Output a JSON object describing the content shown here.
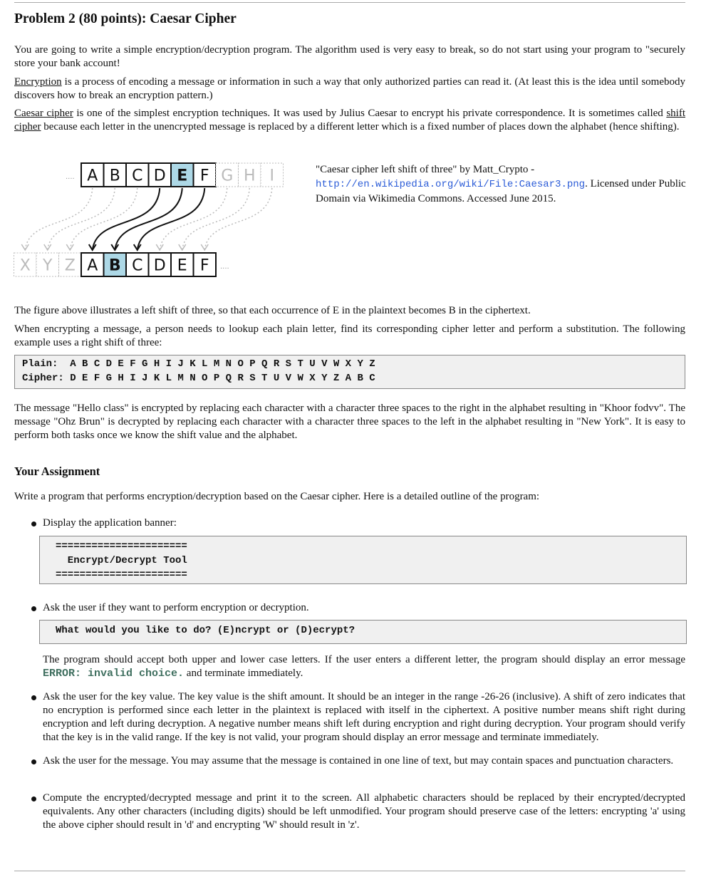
{
  "title": "Problem 2 (80 points): Caesar Cipher",
  "intro": {
    "p1": "You are going to write a simple encryption/decryption program. The algorithm used is very easy to break, so do not start using your program to \"securely store your bank account!",
    "p2_link": "Encryption",
    "p2": " is a process of encoding a message or information in such a way that only authorized parties can read it. (At least this is the idea until somebody discovers how to break an encryption pattern.)",
    "p3_link1": "Caesar cipher",
    "p3_a": " is one of the simplest encryption techniques. It was used by Julius Caesar to encrypt his private correspondence. It is sometimes called ",
    "p3_link2": "shift cipher",
    "p3_b": " because each letter in the unencrypted message is replaced by a different letter which is a fixed number of places down the alphabet (hence shifting)."
  },
  "figure": {
    "top_letters": [
      "A",
      "B",
      "C",
      "D",
      "E",
      "F"
    ],
    "top_gray": [
      "G",
      "H",
      "I"
    ],
    "bottom_gray": [
      "X",
      "Y",
      "Z"
    ],
    "bottom_letters": [
      "A",
      "B",
      "C",
      "D",
      "E",
      "F"
    ],
    "ellipsis": "....",
    "highlight_color": "#add8e6",
    "caption_a": "\"Caesar cipher left shift of three\" by Matt_Crypto - ",
    "caption_url": "http://en.wikipedia.org/wiki/File:Caesar3.png",
    "caption_b": ". Licensed under Public Domain via Wikimedia Commons. Accessed June 2015."
  },
  "p4": "The figure above illustrates a left shift of three, so that each occurrence of E in the plaintext becomes B in the ciphertext.",
  "p5": "When encrypting a message, a person needs to lookup each plain letter, find its corresponding cipher letter and perform a substitution. The following example uses a right shift of three:",
  "table": {
    "plain": "Plain:  A B C D E F G H I J K L M N O P Q R S T U V W X Y Z",
    "cipher": "Cipher: D E F G H I J K L M N O P Q R S T U V W X Y Z A B C"
  },
  "p6": "The message \"Hello class\" is encrypted by replacing each character with a character three spaces to the right in the alphabet resulting in \"Khoor fodvv\". The message \"Ohz Brun\" is decrypted by replacing each character with a character three spaces to the left in the alphabet resulting in \"New York\". It is easy to perform both tasks once we know the shift value and the alphabet.",
  "assignment": {
    "heading": "Your Assignment",
    "intro": "Write a program that performs encryption/decryption based on the Caesar cipher. Here is a detailed outline of the program:",
    "b1": "Display the application banner:",
    "banner": [
      "======================",
      "  Encrypt/Decrypt Tool",
      "======================"
    ],
    "b2": "Ask the user if they want to perform encryption or decryption.",
    "prompt": "What would you like to do? (E)ncrypt or (D)ecrypt?",
    "b2_note_a": "The program should accept both upper and lower case letters. If the user enters a different letter, the program should display an error message ",
    "b2_err": "ERROR: invalid choice.",
    "b2_note_b": " and terminate immediately.",
    "b3": "Ask the user for the key value. The key value is the shift amount. It should be an integer in the range -26-26 (inclusive). A shift of zero indicates that no encryption is performed since each letter in the plaintext is replaced with itself in the ciphertext. A positive number means shift right during encryption and left during decryption. A negative number means shift left during encryption and right during decryption. Your program should verify that the key is in the valid range. If the key is not valid, your program should display an error message and terminate immediately.",
    "b4": "Ask the user for the message. You may assume that the message is contained in one line of text, but may contain spaces and punctuation characters.",
    "b5": "Compute the encrypted/decrypted message and print it to the screen. All alphabetic characters should be replaced by their encrypted/decrypted equivalents. Any other characters (including digits) should be left unmodified. Your program should preserve case of the letters: encrypting 'a' using the above cipher should result in 'd' and encrypting 'W' should result in 'z'."
  }
}
